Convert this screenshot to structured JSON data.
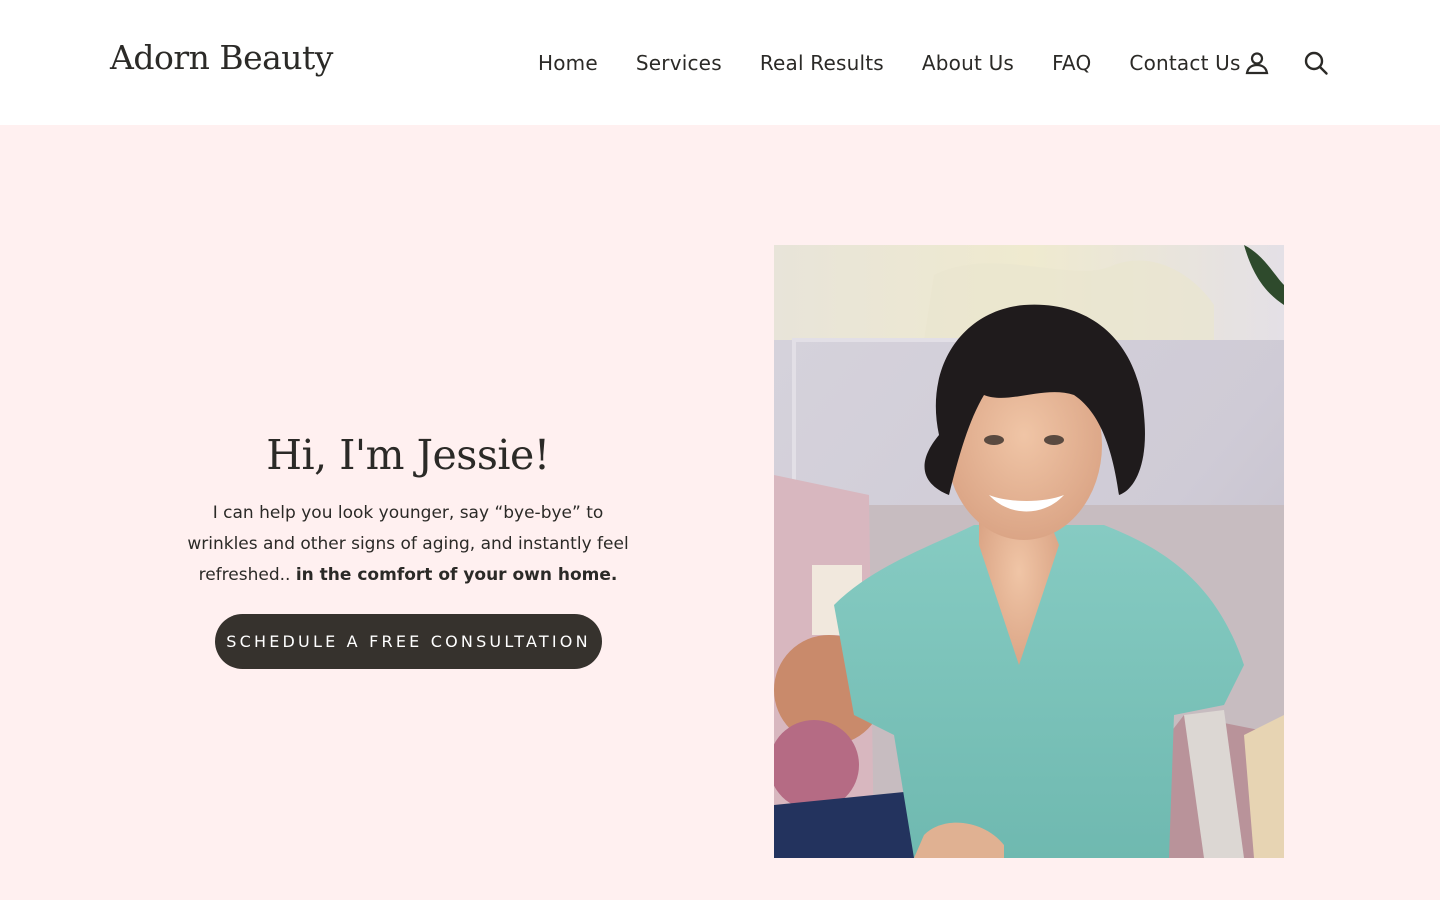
{
  "header": {
    "logo": "Adorn Beauty",
    "nav": [
      {
        "label": "Home"
      },
      {
        "label": "Services"
      },
      {
        "label": "Real Results"
      },
      {
        "label": "About Us"
      },
      {
        "label": "FAQ"
      },
      {
        "label": "Contact Us"
      }
    ],
    "icons": [
      "account-icon",
      "search-icon"
    ]
  },
  "hero": {
    "title": "Hi, I'm Jessie!",
    "body": "I can help you look younger, say “bye-bye” to wrinkles and other signs of aging, and instantly feel refreshed..",
    "body_bold": "in the comfort of your own home.",
    "cta": "SCHEDULE A FREE CONSULTATION"
  },
  "colors": {
    "hero_background": "#fff0f0",
    "button_background": "#36322d",
    "text": "#2b2a27"
  }
}
